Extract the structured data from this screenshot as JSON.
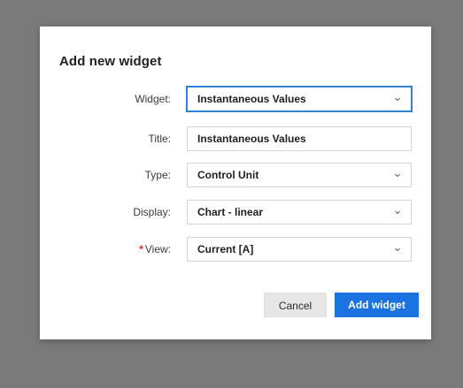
{
  "dialog": {
    "title": "Add new widget",
    "fields": [
      {
        "label": "Widget:",
        "value": "Instantaneous Values",
        "kind": "select",
        "required": false,
        "focused": true
      },
      {
        "label": "Title:",
        "value": "Instantaneous Values",
        "kind": "text",
        "required": false,
        "focused": false
      },
      {
        "label": "Type:",
        "value": "Control Unit",
        "kind": "select",
        "required": false,
        "focused": false
      },
      {
        "label": "Display:",
        "value": "Chart - linear",
        "kind": "select",
        "required": false,
        "focused": false
      },
      {
        "label": "View:",
        "value": "Current [A]",
        "kind": "select",
        "required": true,
        "required_marker": "*",
        "focused": false
      }
    ],
    "buttons": {
      "cancel_label": "Cancel",
      "add_label": "Add widget"
    }
  },
  "colors": {
    "backdrop": "#7a7a7a",
    "accent": "#1a73e0",
    "required": "#e0252b",
    "focus_border": "#2f7fdc"
  },
  "icons": {
    "dropdown": "chevron-down-icon"
  }
}
